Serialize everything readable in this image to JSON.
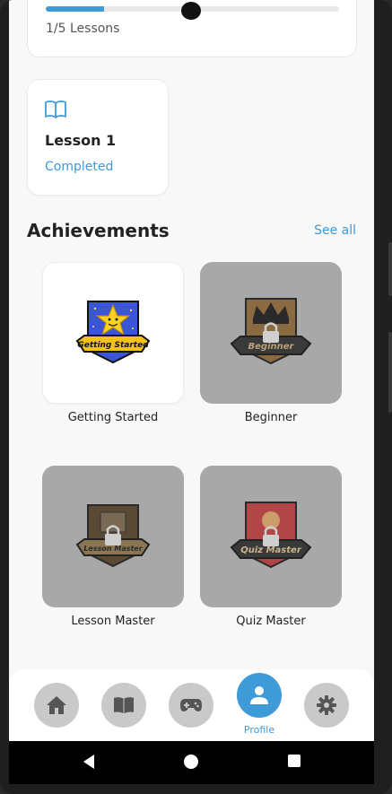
{
  "progress": {
    "fraction": 0.2,
    "text": "1/5 Lessons"
  },
  "lesson_card": {
    "icon": "book-open-icon",
    "title": "Lesson 1",
    "status": "Completed"
  },
  "achievements": {
    "title": "Achievements",
    "see_all": "See all",
    "items": [
      {
        "label": "Getting Started",
        "badge_text": "Getting Started",
        "locked": false
      },
      {
        "label": "Beginner",
        "badge_text": "Beginner",
        "locked": true
      },
      {
        "label": "Lesson Master",
        "badge_text": "Lesson Master",
        "locked": true
      },
      {
        "label": "Quiz Master",
        "badge_text": "Quiz Master",
        "locked": true
      }
    ]
  },
  "nav": {
    "items": [
      {
        "icon": "home-icon",
        "active": false
      },
      {
        "icon": "book-icon",
        "active": false
      },
      {
        "icon": "gamepad-icon",
        "active": false
      },
      {
        "icon": "profile-icon",
        "active": true,
        "label": "Profile"
      },
      {
        "icon": "gear-icon",
        "active": false
      }
    ]
  },
  "colors": {
    "accent": "#3f9ad8",
    "locked_tile": "#a8a8a8"
  }
}
